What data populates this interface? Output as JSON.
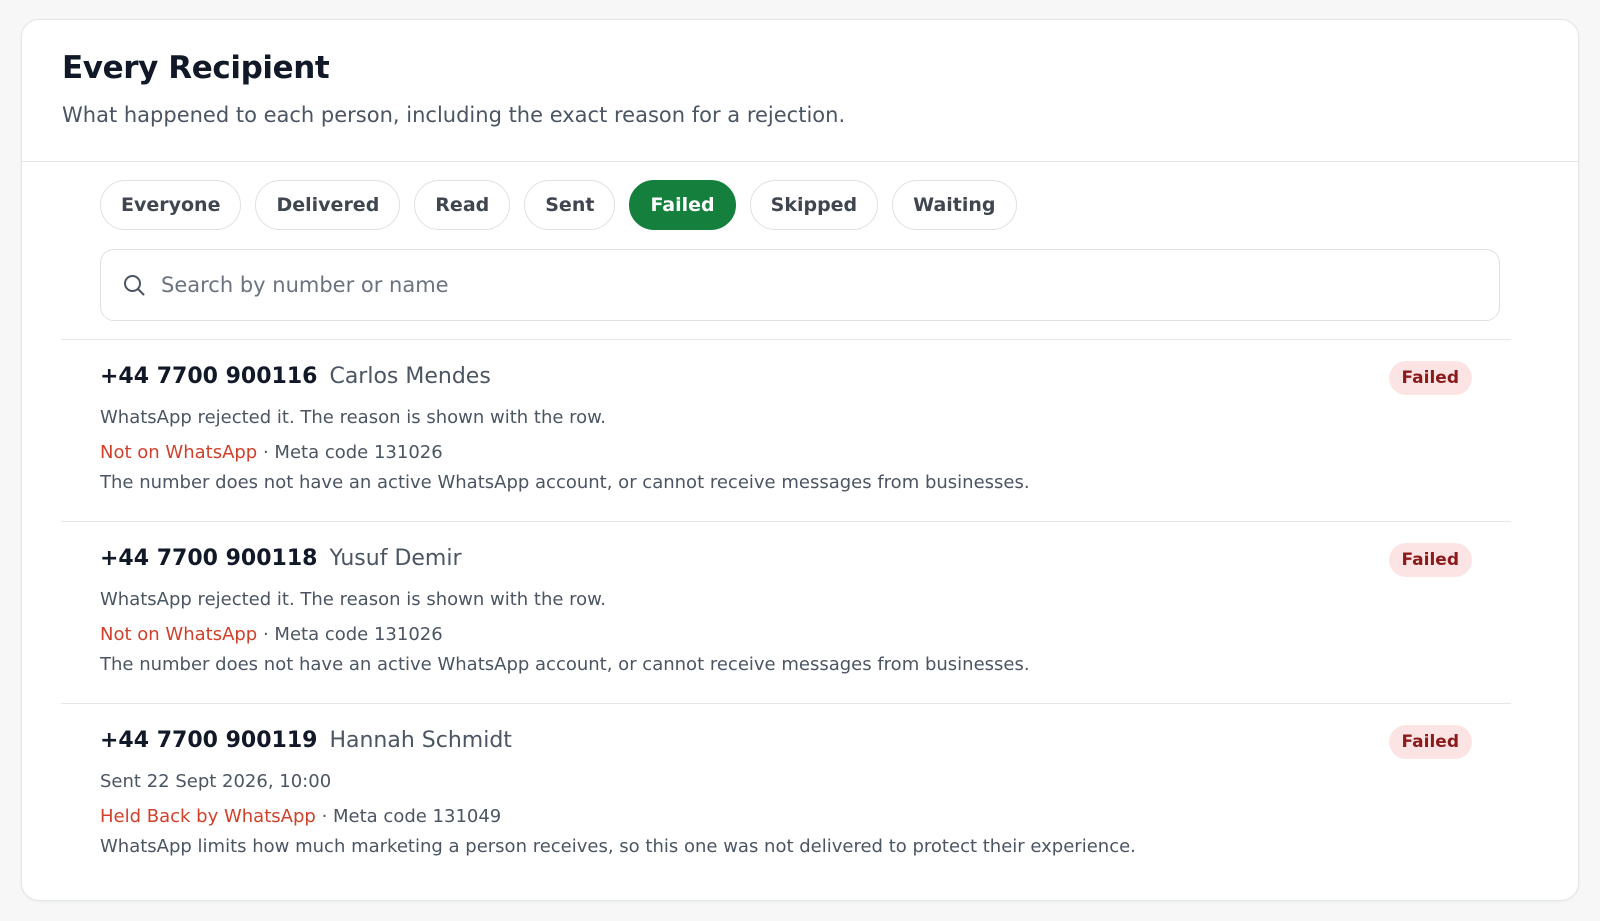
{
  "header": {
    "title": "Every Recipient",
    "subtitle": "What happened to each person, including the exact reason for a rejection."
  },
  "filters": [
    {
      "label": "Everyone",
      "active": false
    },
    {
      "label": "Delivered",
      "active": false
    },
    {
      "label": "Read",
      "active": false
    },
    {
      "label": "Sent",
      "active": false
    },
    {
      "label": "Failed",
      "active": true
    },
    {
      "label": "Skipped",
      "active": false
    },
    {
      "label": "Waiting",
      "active": false
    }
  ],
  "search": {
    "placeholder": "Search by number or name",
    "value": "",
    "icon": "search-icon"
  },
  "recipients": [
    {
      "phone": "+44 7700 900116",
      "name": "Carlos Mendes",
      "detail": "WhatsApp rejected it. The reason is shown with the row.",
      "reason": "Not on WhatsApp",
      "code": "· Meta code 131026",
      "explanation": "The number does not have an active WhatsApp account, or cannot receive messages from businesses.",
      "status": "Failed"
    },
    {
      "phone": "+44 7700 900118",
      "name": "Yusuf Demir",
      "detail": "WhatsApp rejected it. The reason is shown with the row.",
      "reason": "Not on WhatsApp",
      "code": "· Meta code 131026",
      "explanation": "The number does not have an active WhatsApp account, or cannot receive messages from businesses.",
      "status": "Failed"
    },
    {
      "phone": "+44 7700 900119",
      "name": "Hannah Schmidt",
      "detail": "Sent 22 Sept 2026, 10:00",
      "reason": "Held Back by WhatsApp",
      "code": "· Meta code 131049",
      "explanation": "WhatsApp limits how much marketing a person receives, so this one was not delivered to protect their experience.",
      "status": "Failed"
    }
  ],
  "colors": {
    "accent": "#15803d",
    "failed_text": "#8b1a1a",
    "failed_bg": "#fde4e4",
    "reason": "#d0402b"
  }
}
